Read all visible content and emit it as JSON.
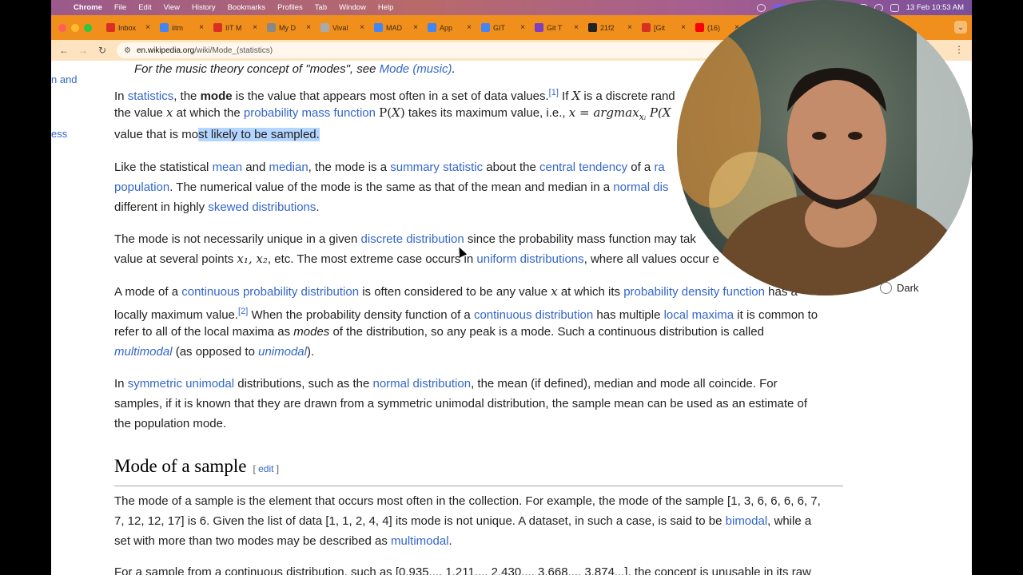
{
  "menubar": {
    "app": "Chrome",
    "items": [
      "File",
      "Edit",
      "View",
      "History",
      "Bookmarks",
      "Profiles",
      "Tab",
      "Window",
      "Help"
    ],
    "datetime": "13 Feb  10:53 AM"
  },
  "tabs": [
    {
      "title": "Inbox",
      "color": "#d93025"
    },
    {
      "title": "iitm",
      "color": "#4285f4"
    },
    {
      "title": "IIT M",
      "color": "#d93025"
    },
    {
      "title": "My D",
      "color": "#888888"
    },
    {
      "title": "Vival",
      "color": "#aaaaaa"
    },
    {
      "title": "MAD",
      "color": "#4285f4"
    },
    {
      "title": "App",
      "color": "#4285f4"
    },
    {
      "title": "GIT",
      "color": "#4285f4"
    },
    {
      "title": "Git T",
      "color": "#7e3fbf"
    },
    {
      "title": "21f2",
      "color": "#222222"
    },
    {
      "title": "[Git",
      "color": "#d93025"
    },
    {
      "title": "(16)",
      "color": "#ff0000"
    }
  ],
  "url": {
    "host": "en.wikipedia.org",
    "path": "/wiki/Mode_(statistics)"
  },
  "sidebar": {
    "link1": "n and",
    "link2": "ess"
  },
  "hatnote": {
    "prefix": "For the music theory concept of \"modes\", see ",
    "link": "Mode (music)",
    "suffix": "."
  },
  "p1": {
    "l1a": "In ",
    "l1_statistics": "statistics",
    "l1b": ", the ",
    "l1_mode": "mode",
    "l1c": " is the value that appears most often in a set of data values.",
    "l1_ref": "[1]",
    "l1d": " If ",
    "l1_X": "X",
    "l1e": " is a discrete rand",
    "l2a": "the value ",
    "l2_x": "x",
    "l2b": " at which the ",
    "l2_pmf": "probability mass function",
    "l2_P": "P(",
    "l2_X": "X",
    "l2_close": ")",
    "l2c": " takes its maximum value, i.e., ",
    "l2_eq": "x = argmax",
    "l2_sub": "xᵢ",
    "l2_P2": " P(X",
    "l3a": "value that is mo",
    "l3_hl": "st likely to be sampled."
  },
  "p2": {
    "l1a": "Like the statistical ",
    "mean": "mean",
    "l1b": " and ",
    "median": "median",
    "l1c": ", the mode is a ",
    "summary": "summary statistic",
    "l1d": " about the ",
    "central": "central tendency",
    "l1e": " of a ",
    "ra": "ra",
    "population": "population",
    "l2b": ". The numerical value of the mode is the same as that of the mean and median in a ",
    "normal": "normal dis",
    "l3a": "different in highly ",
    "skewed": "skewed distributions",
    "l3b": "."
  },
  "p3": {
    "l1a": "The mode is not necessarily unique in a given ",
    "discrete": "discrete distribution",
    "l1b": " since the probability mass function may tak",
    "l2a": "value at several points ",
    "x1": "x₁, x₂",
    "l2b": ", etc. The most extreme case occurs in ",
    "uniform": "uniform distributions",
    "l2c": ", where all values occur e"
  },
  "p4": {
    "l1a": "A mode of a ",
    "cpd": "continuous probability distribution",
    "l1b": " is often considered to be any value ",
    "x": "x",
    "l1c": " at which its ",
    "pdf": "probability density function",
    "l1d": " has a",
    "l2a": "locally maximum value.",
    "ref": "[2]",
    "l2b": " When the probability density function of a ",
    "cd": "continuous distribution",
    "l2c": " has multiple ",
    "lm": "local maxima",
    "l2d": " it is common to",
    "l3a": "refer to all of the local maxima as ",
    "modes": "modes",
    "l3b": " of the distribution, so any peak is a mode. Such a continuous distribution is called",
    "multimodal": "multimodal",
    "l4b": " (as opposed to ",
    "unimodal": "unimodal",
    "l4c": ")."
  },
  "p5": {
    "l1a": "In ",
    "symm": "symmetric unimodal",
    "l1b": " distributions, such as the ",
    "normal": "normal distribution",
    "l1c": ", the mean (if defined), median and mode all coincide. For",
    "l2": "samples, if it is known that they are drawn from a symmetric unimodal distribution, the sample mean can be used as an estimate of",
    "l3": "the population mode."
  },
  "section": {
    "title": "Mode of a sample",
    "edit_open": "[ ",
    "edit": "edit",
    "edit_close": " ]"
  },
  "p6": {
    "l1": "The mode of a sample is the element that occurs most often in the collection. For example, the mode of the sample [1, 3, 6, 6, 6, 6, 7,",
    "l2a": "7, 12, 12, 17] is 6. Given the list of data [1, 1, 2, 4, 4] its mode is not unique. A dataset, in such a case, is said to be ",
    "bimodal": "bimodal",
    "l2b": ", while a",
    "l3a": "set with more than two modes may be described as ",
    "multimodal": "multimodal",
    "l3b": "."
  },
  "p7": {
    "l1": "For a sample from a continuous distribution, such as [0.935..., 1.211..., 2.430..., 3.668..., 3.874...], the concept is unusable in its raw"
  },
  "appearance": {
    "dark": "Dark"
  }
}
